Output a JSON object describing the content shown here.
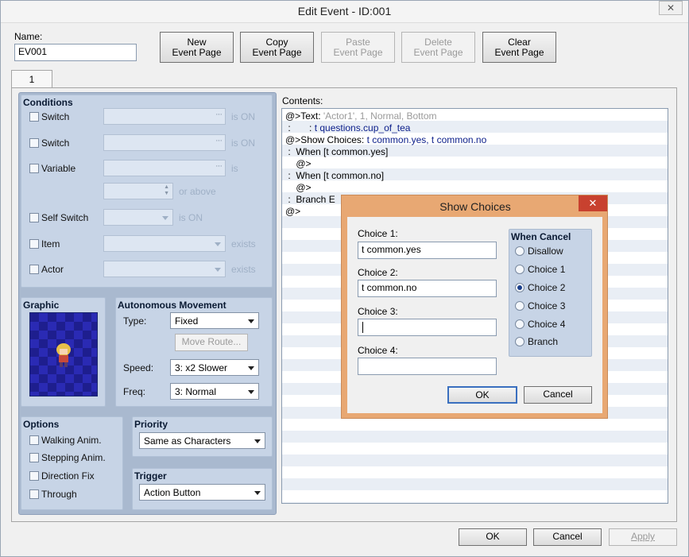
{
  "window": {
    "title": "Edit Event - ID:001",
    "close_icon": "close-icon"
  },
  "name": {
    "label": "Name:",
    "value": "EV001"
  },
  "toolbar": {
    "new": [
      "New",
      "Event Page"
    ],
    "copy": [
      "Copy",
      "Event Page"
    ],
    "paste": [
      "Paste",
      "Event Page"
    ],
    "delete": [
      "Delete",
      "Event Page"
    ],
    "clear": [
      "Clear",
      "Event Page"
    ]
  },
  "tabs": [
    {
      "label": "1"
    }
  ],
  "conditions": {
    "title": "Conditions",
    "switch1": {
      "label": "Switch",
      "suffix": "is ON"
    },
    "switch2": {
      "label": "Switch",
      "suffix": "is ON"
    },
    "variable": {
      "label": "Variable",
      "suffix": "is",
      "suffix2": "or above"
    },
    "self_switch": {
      "label": "Self Switch",
      "suffix": "is ON"
    },
    "item": {
      "label": "Item",
      "suffix": "exists"
    },
    "actor": {
      "label": "Actor",
      "suffix": "exists"
    }
  },
  "graphic": {
    "title": "Graphic"
  },
  "movement": {
    "title": "Autonomous Movement",
    "type_label": "Type:",
    "type_value": "Fixed",
    "move_route": "Move Route...",
    "speed_label": "Speed:",
    "speed_value": "3: x2 Slower",
    "freq_label": "Freq:",
    "freq_value": "3: Normal"
  },
  "options": {
    "title": "Options",
    "items": [
      "Walking Anim.",
      "Stepping Anim.",
      "Direction Fix",
      "Through"
    ]
  },
  "priority": {
    "title": "Priority",
    "value": "Same as Characters"
  },
  "trigger": {
    "title": "Trigger",
    "value": "Action Button"
  },
  "contents": {
    "label": "Contents:",
    "lines": [
      {
        "a": "@>Text: ",
        "g": "'Actor1', 1, Normal, Bottom",
        "b": ""
      },
      {
        "a": " :       : ",
        "g": "",
        "b": "t questions.cup_of_tea"
      },
      {
        "a": "@>Show Choices: ",
        "g": "",
        "b": "t common.yes, t common.no"
      },
      {
        "a": " :  When [t common.yes]",
        "g": "",
        "b": ""
      },
      {
        "a": "    @>",
        "g": "",
        "b": ""
      },
      {
        "a": " :  When [t common.no]",
        "g": "",
        "b": ""
      },
      {
        "a": "    @>",
        "g": "",
        "b": ""
      },
      {
        "a": " :  Branch E",
        "g": "",
        "b": ""
      },
      {
        "a": "@>",
        "g": "",
        "b": ""
      }
    ]
  },
  "dialog": {
    "title": "Show Choices",
    "choice1": {
      "label": "Choice 1:",
      "value": "t common.yes"
    },
    "choice2": {
      "label": "Choice 2:",
      "value": "t common.no"
    },
    "choice3": {
      "label": "Choice 3:",
      "value": ""
    },
    "choice4": {
      "label": "Choice 4:",
      "value": ""
    },
    "when_cancel": {
      "title": "When Cancel",
      "options": [
        "Disallow",
        "Choice 1",
        "Choice 2",
        "Choice 3",
        "Choice 4",
        "Branch"
      ],
      "selected": "Choice 2"
    },
    "ok": "OK",
    "cancel": "Cancel"
  },
  "footer": {
    "ok": "OK",
    "cancel": "Cancel",
    "apply": "Apply"
  },
  "colors": {
    "panel": "#a9b9cf",
    "section": "#c7d4e6",
    "dialog_frame": "#e8a873",
    "close_red": "#c8412f"
  }
}
